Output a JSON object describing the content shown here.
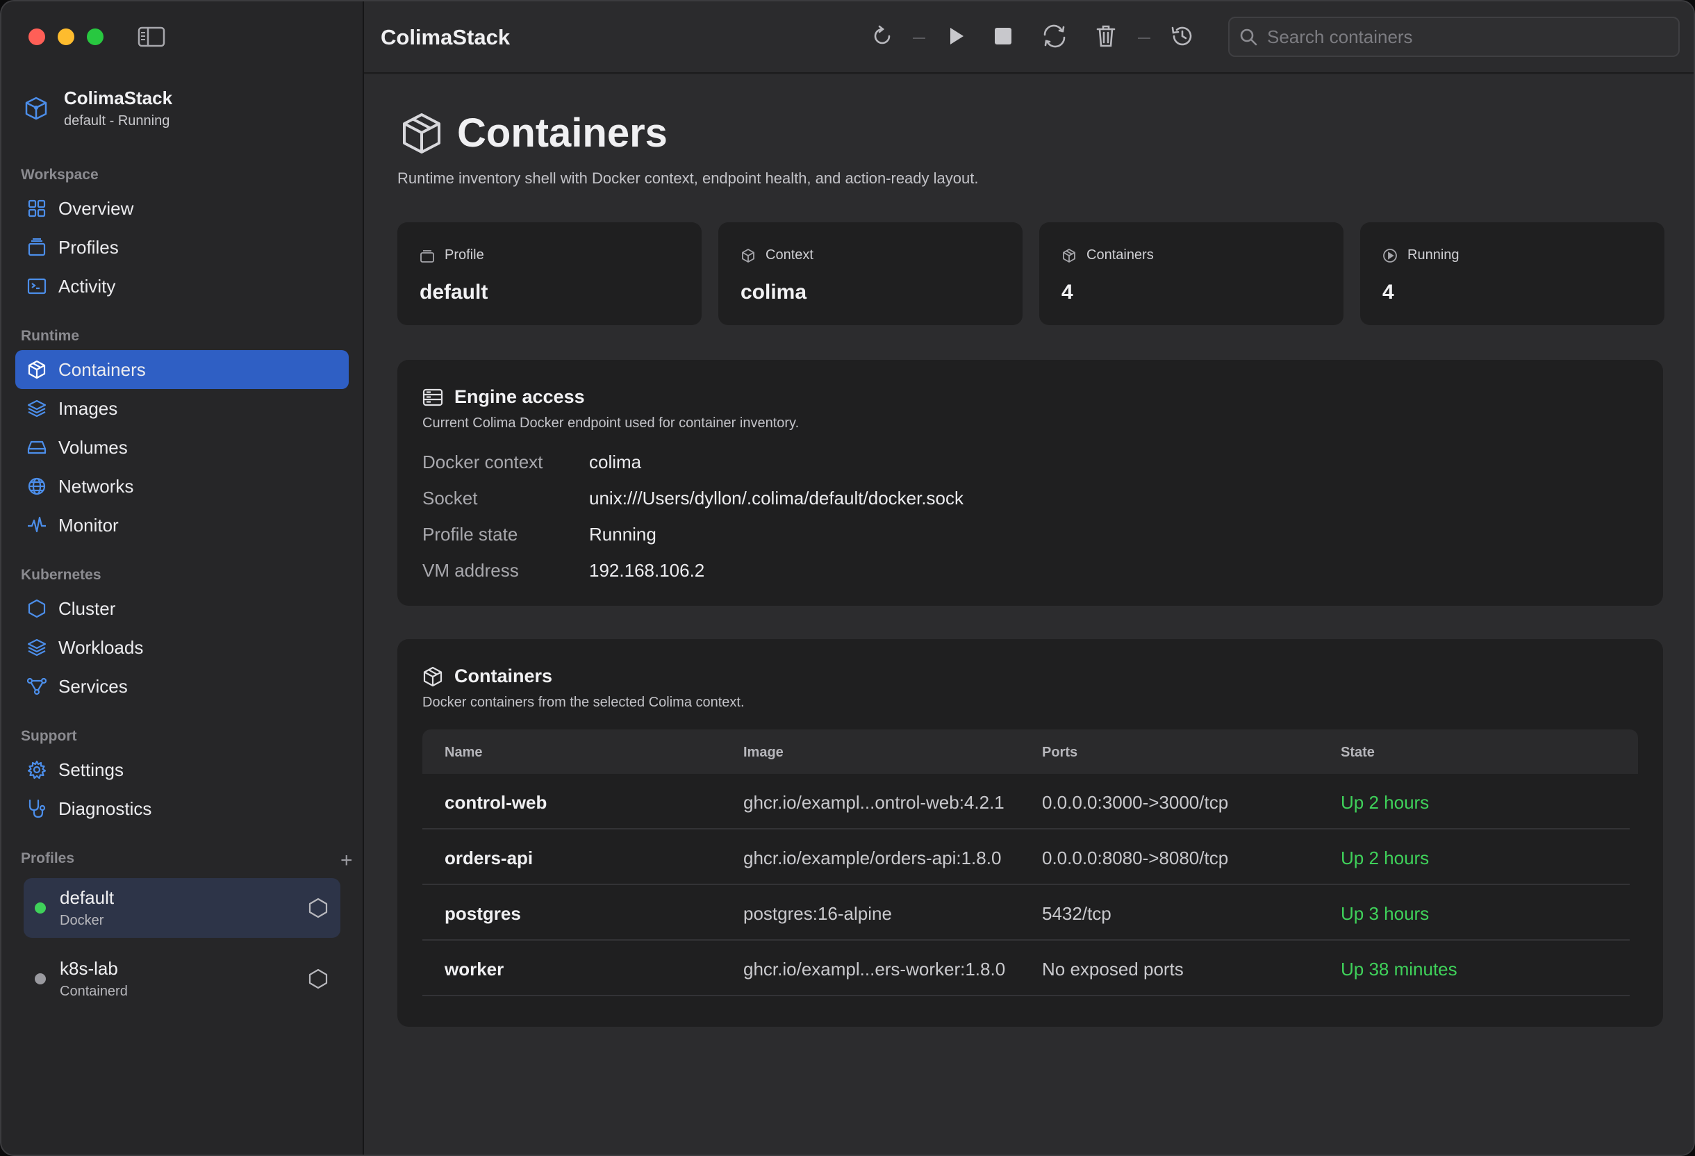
{
  "app": {
    "title": "ColimaStack",
    "brand_title": "ColimaStack",
    "brand_subtitle": "default - Running"
  },
  "colors": {
    "accent": "#2f5fc4",
    "icon_blue": "#4c8eea",
    "running_green": "#3fd15a",
    "window_red": "#ff5f57",
    "window_yellow": "#febc2e",
    "window_green": "#28c840"
  },
  "sidebar": {
    "sections": [
      {
        "label": "Workspace",
        "items": [
          {
            "label": "Overview",
            "icon": "grid-icon"
          },
          {
            "label": "Profiles",
            "icon": "stack-icon"
          },
          {
            "label": "Activity",
            "icon": "terminal-icon"
          }
        ]
      },
      {
        "label": "Runtime",
        "items": [
          {
            "label": "Containers",
            "icon": "box-icon",
            "active": true
          },
          {
            "label": "Images",
            "icon": "layers-icon"
          },
          {
            "label": "Volumes",
            "icon": "drive-icon"
          },
          {
            "label": "Networks",
            "icon": "globe-icon"
          },
          {
            "label": "Monitor",
            "icon": "pulse-icon"
          }
        ]
      },
      {
        "label": "Kubernetes",
        "items": [
          {
            "label": "Cluster",
            "icon": "hexagon-icon"
          },
          {
            "label": "Workloads",
            "icon": "layers-icon"
          },
          {
            "label": "Services",
            "icon": "nodes-icon"
          }
        ]
      },
      {
        "label": "Support",
        "items": [
          {
            "label": "Settings",
            "icon": "gear-icon"
          },
          {
            "label": "Diagnostics",
            "icon": "stethoscope-icon"
          }
        ]
      }
    ],
    "profiles_label": "Profiles",
    "profiles": [
      {
        "name": "default",
        "runtime": "Docker",
        "status": "running",
        "active": true
      },
      {
        "name": "k8s-lab",
        "runtime": "Containerd",
        "status": "stopped",
        "active": false
      }
    ]
  },
  "toolbar": {
    "search_placeholder": "Search containers",
    "icons": [
      "refresh-icon",
      "play-icon",
      "stop-icon",
      "restart-icon",
      "trash-icon",
      "history-icon"
    ]
  },
  "page": {
    "title": "Containers",
    "subtitle": "Runtime inventory shell with Docker context, endpoint health, and action-ready layout."
  },
  "stats": [
    {
      "label": "Profile",
      "value": "default",
      "icon": "stack-icon"
    },
    {
      "label": "Context",
      "value": "colima",
      "icon": "cube-icon"
    },
    {
      "label": "Containers",
      "value": "4",
      "icon": "box-icon"
    },
    {
      "label": "Running",
      "value": "4",
      "icon": "play-circle-icon"
    }
  ],
  "engine": {
    "title": "Engine access",
    "subtitle": "Current Colima Docker endpoint used for container inventory.",
    "rows": [
      {
        "key": "Docker context",
        "value": "colima"
      },
      {
        "key": "Socket",
        "value": "unix:///Users/dyllon/.colima/default/docker.sock"
      },
      {
        "key": "Profile state",
        "value": "Running"
      },
      {
        "key": "VM address",
        "value": "192.168.106.2"
      }
    ]
  },
  "containers": {
    "title": "Containers",
    "subtitle": "Docker containers from the selected Colima context.",
    "columns": [
      "Name",
      "Image",
      "Ports",
      "State"
    ],
    "rows": [
      {
        "name": "control-web",
        "image": "ghcr.io/exampl...ontrol-web:4.2.1",
        "ports": "0.0.0.0:3000->3000/tcp",
        "state": "Up 2 hours"
      },
      {
        "name": "orders-api",
        "image": "ghcr.io/example/orders-api:1.8.0",
        "ports": "0.0.0.0:8080->8080/tcp",
        "state": "Up 2 hours"
      },
      {
        "name": "postgres",
        "image": "postgres:16-alpine",
        "ports": "5432/tcp",
        "state": "Up 3 hours"
      },
      {
        "name": "worker",
        "image": "ghcr.io/exampl...ers-worker:1.8.0",
        "ports": "No exposed ports",
        "state": "Up 38 minutes"
      }
    ]
  }
}
